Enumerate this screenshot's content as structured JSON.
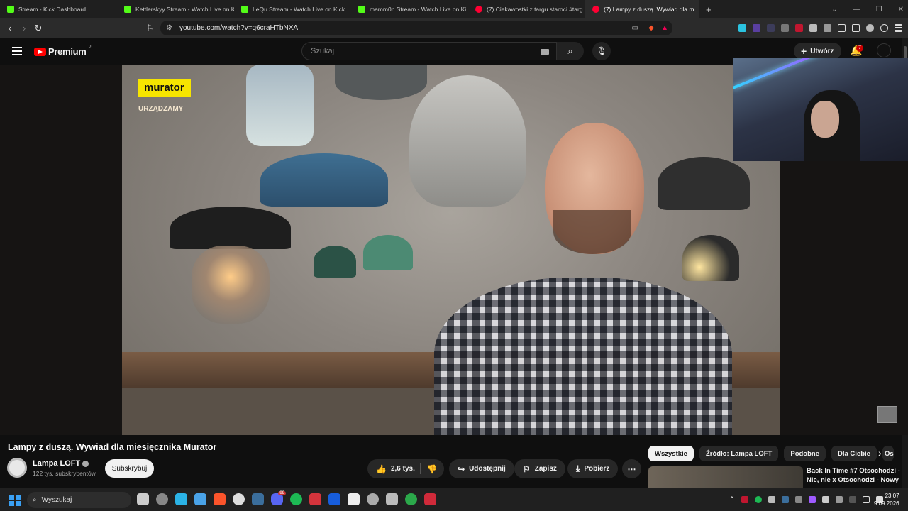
{
  "tabs": [
    {
      "label": "Stream - Kick Dashboard",
      "color": "#53fc18",
      "active": false
    },
    {
      "label": "Kettlerskyy Stream - Watch Live on K",
      "color": "#53fc18",
      "active": false
    },
    {
      "label": "LeQu Stream - Watch Live on Kick",
      "color": "#53fc18",
      "active": false
    },
    {
      "label": "mamm0n Stream - Watch Live on Ki",
      "color": "#53fc18",
      "active": false
    },
    {
      "label": "(7) Ciekawostki z targu staroci #targ",
      "color": "#ff0033",
      "active": false
    },
    {
      "label": "(7) Lampy z duszą. Wywiad dla m",
      "color": "#ff0033",
      "active": true
    }
  ],
  "address": {
    "url": "youtube.com/watch?v=q6craHTbNXA"
  },
  "youtube": {
    "logo_text": "Premium",
    "region": "PL",
    "search_placeholder": "Szukaj",
    "create_label": "Utwórz",
    "notifications_count": "7"
  },
  "video": {
    "brand_label": "murator",
    "brand_sub": "URZĄDZAMY",
    "title": "Lampy z duszą. Wywiad dla miesięcznika Murator"
  },
  "channel": {
    "name": "Lampa LOFT",
    "subscribers": "122 tys. subskrybentów",
    "subscribe_label": "Subskrybuj"
  },
  "actions": {
    "likes": "2,6 tys.",
    "share": "Udostępnij",
    "save": "Zapisz",
    "download": "Pobierz"
  },
  "chips": [
    "Wszystkie",
    "Źródło: Lampa LOFT",
    "Podobne",
    "Dla Ciebie",
    "Os"
  ],
  "recommendation": {
    "title": "Back In Time #7 Otsochodzi - Nie, nie x Otsochodzi - Nowy"
  },
  "taskbar": {
    "search_placeholder": "Wyszukaj",
    "time": "23:07",
    "date": "9.09.2026",
    "discord_badge": "99"
  }
}
